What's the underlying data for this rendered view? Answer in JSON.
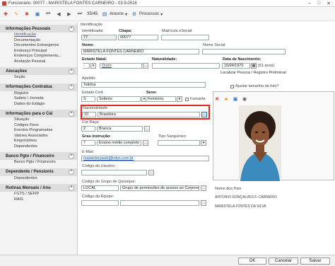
{
  "window": {
    "title": "Funcionário: 00077 - MARISTELA FONTES CARNEIRO - 03.9.0516",
    "minimize": "–",
    "maximize": "□",
    "close": "✕"
  },
  "toolbar": {
    "record_pos": "35/45",
    "annexes": "Anexos",
    "processes": "Processos"
  },
  "sidebar": {
    "sections": [
      {
        "title": "Informações Pessoais",
        "items": [
          "Identificação",
          "Documentação",
          "Documentos Estrangeiros",
          "Endereço Principal",
          "Endereços Complementa...",
          "Anotação Pessoal"
        ]
      },
      {
        "title": "Alocações",
        "items": [
          "Seção"
        ]
      },
      {
        "title": "Informações Contratua",
        "items": [
          "Registro",
          "Salário / Jornada",
          "Dados do Estágio"
        ]
      },
      {
        "title": "Informações para o Cál",
        "items": [
          "Situação",
          "Códigos Fixos",
          "Eventos Programados",
          "Valores Associados",
          "Empréstimos",
          "Dependentes"
        ]
      },
      {
        "title": "Banco Pgto / Financeiro",
        "items": [
          "Banco Pgto / Financeiro"
        ]
      },
      {
        "title": "Dependente / Pensionis",
        "items": [
          "Dependentes"
        ]
      },
      {
        "title": "Rotinas Mensais / Anu",
        "items": [
          "FGTS / SEFIP",
          "RAIS"
        ]
      }
    ]
  },
  "form": {
    "section_label": "Identificação",
    "identificador_label": "Identificador",
    "identificador": "77",
    "chapa_label": "Chapa:",
    "chapa": "00077",
    "matricula_label": "Matrícula eSocial:",
    "matricula": "",
    "nome_label": "Nome:",
    "nome": "MARISTELA FONTES CARNEIRO",
    "nome_social_label": "Nome Social:",
    "nome_social": "",
    "estado_natal_label": "Estado Natal:",
    "estado_natal": "-",
    "naturalidade_label": "Naturalidade:",
    "naturalidade": "Outro",
    "nascimento_label": "Data de Nascimento:",
    "nascimento": "15/04/1970",
    "idade": "(51 anos)",
    "localizar_link": "Localizar Pessoa / Registro Preliminar",
    "apelido_label": "Apelido:",
    "apelido": "Telinha",
    "ajustar_foto": "Ajustar tamanho da foto?",
    "estado_civil_label": "Estado Civil:",
    "estado_civil_code": "S",
    "estado_civil": "Solteiro",
    "sexo_label": "Sexo:",
    "sexo": "Feminino",
    "fumante": "Fumante",
    "nacionalidade_label": "Nacionalidade:",
    "nacionalidade_code": "10",
    "nacionalidade": "Brasileira",
    "cor_raca_label": "Cor Raça:",
    "cor_raca_code": "2",
    "cor_raca": "Branca",
    "grau_label": "Grau instrução:",
    "grau_code": "7",
    "grau": "Ensino médio completo",
    "tipo_sanguineo_label": "Tipo Sanguíneo:",
    "tipo_sanguineo": "",
    "email_label": "E-Mail:",
    "email": "masterkeyweb@totvs.com.br",
    "codigo_usuario_label": "Código do Usuário:",
    "codigo_usuario": "",
    "grupo_quiosque_label": "Código do Grupo de Quiosque:",
    "grupo_quiosque_code": "LOCAL",
    "grupo_quiosque": "Grupo de permissões de acesso ao Corpore!",
    "codigo_equipe_label": "Código da Equipe:",
    "codigo_equipe": "",
    "nome_pais_label": "Nome dos Pais",
    "pai": "ANTONIO GONÇALVES F. CARNEIRO",
    "mae": "MARISTELA FONTES DA SILVA"
  },
  "footer": {
    "ok": "OK",
    "cancel": "Cancelar",
    "save": "Salvar"
  },
  "colors": {
    "highlight": "#e0281b",
    "link": "#1a4fa0"
  }
}
